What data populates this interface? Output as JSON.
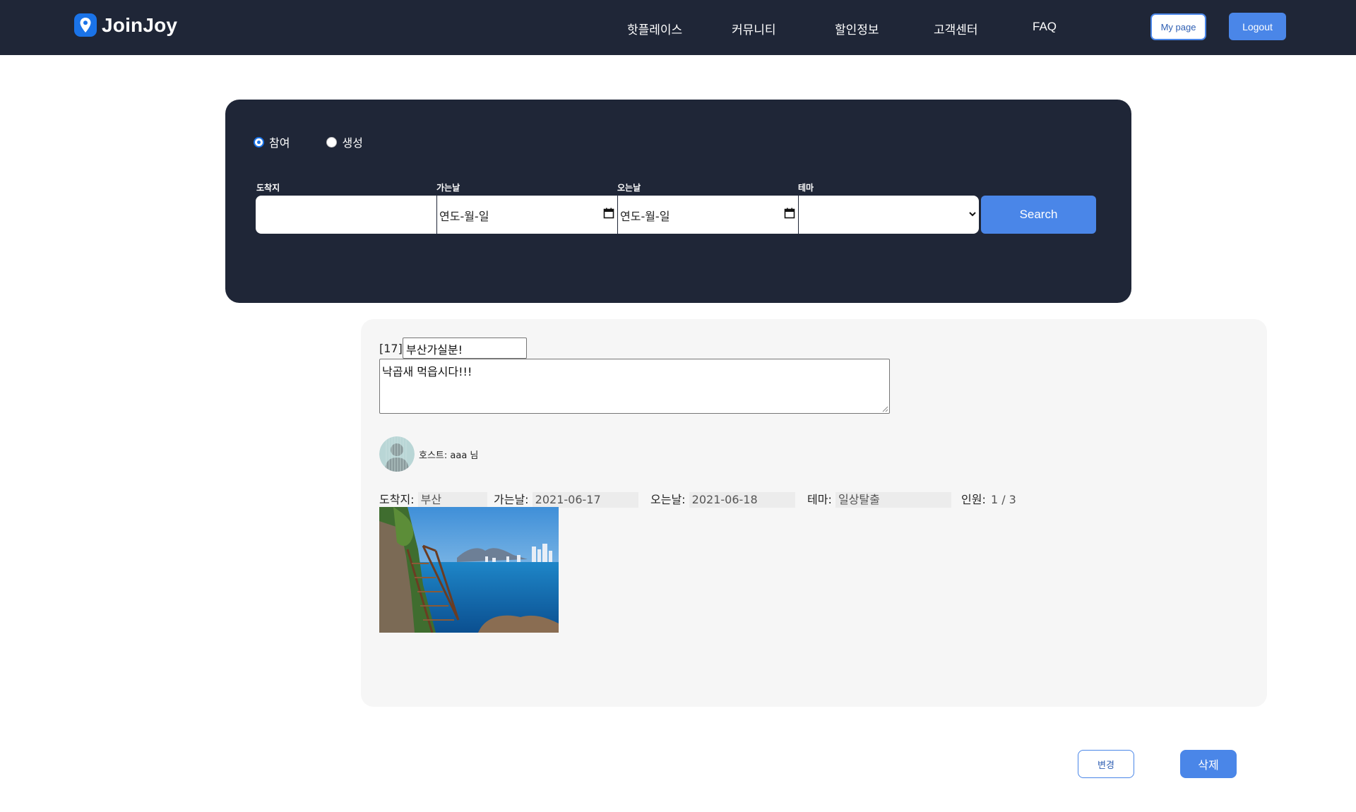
{
  "header": {
    "brand_name": "JoinJoy",
    "nav": [
      {
        "label": "핫플레이스"
      },
      {
        "label": "커뮤니티"
      },
      {
        "label": "할인정보"
      },
      {
        "label": "고객센터"
      },
      {
        "label": "FAQ"
      }
    ],
    "mypage_label": "My page",
    "logout_label": "Logout"
  },
  "search": {
    "radios": [
      {
        "label": "참여",
        "checked": true
      },
      {
        "label": "생성",
        "checked": false
      }
    ],
    "fields": {
      "destination_label": "도착지",
      "destination_value": "",
      "depart_label": "가는날",
      "depart_value": "연도-월-일",
      "return_label": "오는날",
      "return_value": "연도-월-일",
      "theme_label": "테마",
      "theme_value": ""
    },
    "search_label": "Search"
  },
  "post": {
    "id_label": "[17]",
    "title_value": "부산가실분!",
    "content_value": "낙곱새 먹읍시다!!!",
    "host_text": "호스트: aaa 님",
    "info": {
      "destination_label": "도착지:",
      "destination_value": "부산",
      "depart_label": "가는날:",
      "depart_value": "2021-06-17",
      "return_label": "오는날:",
      "return_value": "2021-06-18",
      "theme_label": "테마:",
      "theme_value": "일상탈출",
      "people_label": "인원:",
      "people_value": "1 / 3"
    }
  },
  "actions": {
    "edit_label": "변경",
    "delete_label": "삭제"
  },
  "colors": {
    "navy": "#1f2637",
    "accent": "#4a86e8",
    "card_bg": "#f6f6f6"
  }
}
